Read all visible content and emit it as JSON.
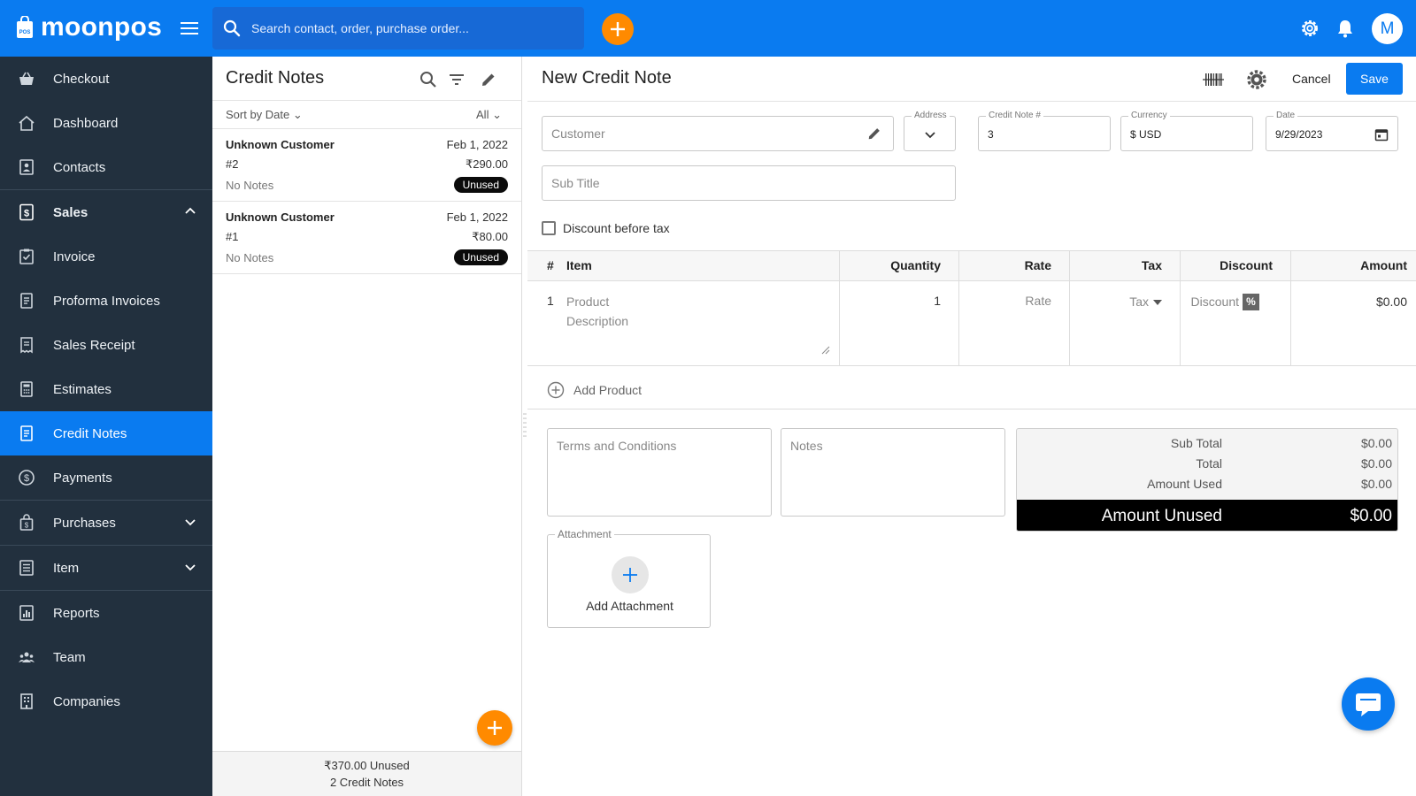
{
  "brand": {
    "name": "moonpos",
    "badge": "POS",
    "color": "#0a7bf0",
    "accent": "#ff8a00"
  },
  "topbar": {
    "search_placeholder": "Search contact, order, purchase order...",
    "avatar_initial": "M"
  },
  "sidebar": {
    "items": [
      {
        "label": "Checkout",
        "icon": "basket-icon"
      },
      {
        "label": "Dashboard",
        "icon": "home-icon"
      },
      {
        "label": "Contacts",
        "icon": "contact-book-icon"
      },
      {
        "label": "Sales",
        "icon": "dollar-document-icon",
        "expanded": true
      },
      {
        "label": "Invoice",
        "icon": "clipboard-check-icon"
      },
      {
        "label": "Proforma Invoices",
        "icon": "document-icon"
      },
      {
        "label": "Sales Receipt",
        "icon": "receipt-icon"
      },
      {
        "label": "Estimates",
        "icon": "calculator-icon"
      },
      {
        "label": "Credit Notes",
        "icon": "credit-note-icon",
        "active": true
      },
      {
        "label": "Payments",
        "icon": "dollar-circle-icon"
      },
      {
        "label": "Purchases",
        "icon": "bag-icon",
        "collapsed": true
      },
      {
        "label": "Item",
        "icon": "list-icon",
        "collapsed": true
      },
      {
        "label": "Reports",
        "icon": "bar-chart-icon"
      },
      {
        "label": "Team",
        "icon": "team-icon"
      },
      {
        "label": "Companies",
        "icon": "building-icon"
      }
    ]
  },
  "list_panel": {
    "title": "Credit Notes",
    "sort_label": "Sort by Date",
    "filter_label": "All",
    "notes": [
      {
        "customer": "Unknown Customer",
        "number": "#2",
        "notes": "No Notes",
        "date": "Feb 1, 2022",
        "amount": "₹290.00",
        "status": "Unused"
      },
      {
        "customer": "Unknown Customer",
        "number": "#1",
        "notes": "No Notes",
        "date": "Feb 1, 2022",
        "amount": "₹80.00",
        "status": "Unused"
      }
    ],
    "footer_total": "₹370.00 Unused",
    "footer_count": "2 Credit Notes"
  },
  "form": {
    "title": "New Credit Note",
    "cancel_label": "Cancel",
    "save_label": "Save",
    "customer_placeholder": "Customer",
    "address_label": "Address",
    "credit_note_label": "Credit Note #",
    "credit_note_value": "3",
    "currency_label": "Currency",
    "currency_value": "$ USD",
    "date_label": "Date",
    "date_value": "9/29/2023",
    "subtitle_placeholder": "Sub Title",
    "discount_before_tax_label": "Discount before tax",
    "discount_before_tax_checked": false,
    "table": {
      "headers": [
        "#",
        "Item",
        "Quantity",
        "Rate",
        "Tax",
        "Discount",
        "Amount"
      ],
      "rows": [
        {
          "index": "1",
          "product_placeholder": "Product",
          "description_placeholder": "Description",
          "quantity": "1",
          "rate_placeholder": "Rate",
          "tax_placeholder": "Tax",
          "discount_placeholder": "Discount",
          "discount_type": "%",
          "amount": "$0.00"
        }
      ]
    },
    "add_product_label": "Add Product",
    "terms_placeholder": "Terms and Conditions",
    "notes_placeholder": "Notes",
    "attachment_label": "Attachment",
    "add_attachment_label": "Add Attachment",
    "totals": {
      "sub_total_label": "Sub Total",
      "sub_total": "$0.00",
      "total_label": "Total",
      "total": "$0.00",
      "amount_used_label": "Amount Used",
      "amount_used": "$0.00",
      "amount_unused_label": "Amount Unused",
      "amount_unused": "$0.00"
    }
  }
}
